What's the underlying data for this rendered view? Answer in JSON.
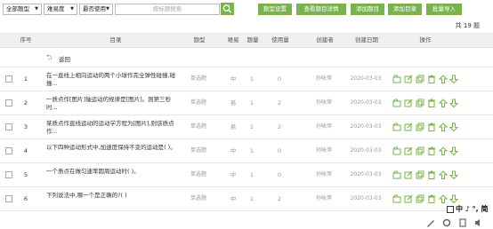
{
  "toolbar": {
    "filter_all_types": "全部题型",
    "filter_difficulty": "难易度",
    "filter_recent": "最否使用",
    "search_placeholder": "按标题搜索",
    "buttons": [
      "题型设置",
      "查看题目详情",
      "添加题目",
      "添加目录",
      "批量导入"
    ]
  },
  "total_count": "共 19 题",
  "columns": [
    "序号",
    "目录",
    "题型",
    "难易",
    "题量",
    "使用量",
    "创建者",
    "创建日期",
    "操作"
  ],
  "back_label": "返回",
  "rows": [
    {
      "num": "1",
      "title": "在一直线上相向运动的两个小球作完全弹性碰撞,碰撞...",
      "type": "单选题",
      "difficulty": "中",
      "score": "1",
      "usage": "0",
      "creator": "孙咏萍",
      "date": "2020-03-03"
    },
    {
      "num": "2",
      "title": "一质点作[图片]轴运动的规律是[图片]。则第三秒时...",
      "type": "单选题",
      "difficulty": "易",
      "score": "1",
      "usage": "2",
      "creator": "孙咏萍",
      "date": "2020-03-03"
    },
    {
      "num": "3",
      "title": "某质点作直线运动的运动学方程为[图片],则该质点作...",
      "type": "单选题",
      "difficulty": "易",
      "score": "1",
      "usage": "2",
      "creator": "孙咏萍",
      "date": "2020-03-03"
    },
    {
      "num": "4",
      "title": "以下四种运动形式中,加速度保持不变的运动是( )。",
      "type": "单选题",
      "difficulty": "中",
      "score": "1",
      "usage": "0",
      "creator": "孙咏萍",
      "date": "2020-03-03"
    },
    {
      "num": "5",
      "title": "一个质点在做匀速率圆周运动时( )。",
      "type": "单选题",
      "difficulty": "中",
      "score": "1",
      "usage": "0",
      "creator": "孙咏萍",
      "date": "2020-03-03"
    },
    {
      "num": "6",
      "title": "下列说法中,哪一个是正确的?( )",
      "type": "单选题",
      "difficulty": "中",
      "score": "1",
      "usage": "2",
      "creator": "孙咏萍",
      "date": "2020-03-03"
    }
  ],
  "row_actions": [
    "move-to-folder-icon",
    "edit-icon",
    "copy-icon",
    "delete-icon",
    "move-up-icon",
    "move-down-icon"
  ],
  "ime_bar": "中 ♪ °, 简",
  "colors": {
    "accent_green": "#7ab24e",
    "header_bg": "#f0f0f0",
    "back_blue": "#4a90c8"
  }
}
